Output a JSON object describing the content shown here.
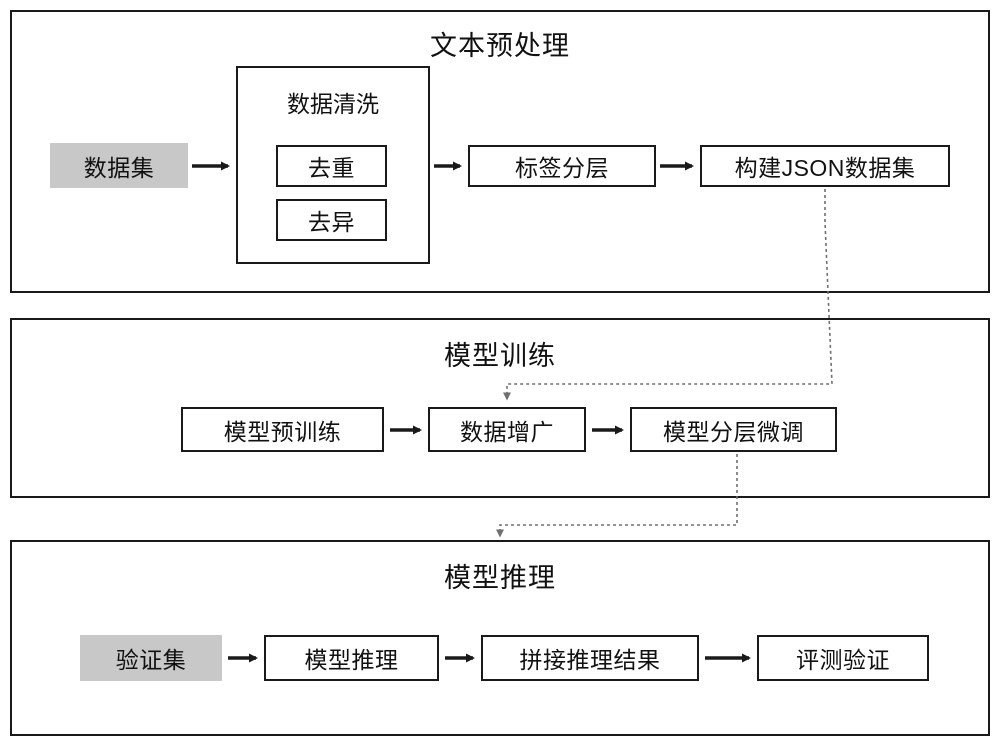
{
  "sections": [
    {
      "id": "preprocessing",
      "title": "文本预处理",
      "nodes": [
        {
          "id": "dataset",
          "label": "数据集",
          "style": "shaded"
        },
        {
          "id": "clean-group-label",
          "label": "数据清洗",
          "style": "group-label"
        },
        {
          "id": "dedup",
          "label": "去重",
          "style": "plain"
        },
        {
          "id": "outlier",
          "label": "去异",
          "style": "plain"
        },
        {
          "id": "label-layering",
          "label": "标签分层",
          "style": "plain"
        },
        {
          "id": "build-json",
          "label": "构建JSON数据集",
          "style": "plain"
        }
      ]
    },
    {
      "id": "training",
      "title": "模型训练",
      "nodes": [
        {
          "id": "pretrain",
          "label": "模型预训练",
          "style": "plain"
        },
        {
          "id": "augment",
          "label": "数据增广",
          "style": "plain"
        },
        {
          "id": "finetune",
          "label": "模型分层微调",
          "style": "plain"
        }
      ]
    },
    {
      "id": "inference",
      "title": "模型推理",
      "nodes": [
        {
          "id": "valset",
          "label": "验证集",
          "style": "shaded"
        },
        {
          "id": "model-infer",
          "label": "模型推理",
          "style": "plain"
        },
        {
          "id": "merge-results",
          "label": "拼接推理结果",
          "style": "plain"
        },
        {
          "id": "evaluate",
          "label": "评测验证",
          "style": "plain"
        }
      ]
    }
  ],
  "colors": {
    "stroke": "#1a1a1a",
    "shaded_fill": "#c8c8c8",
    "background": "#ffffff",
    "dotted_connector": "#707070"
  }
}
